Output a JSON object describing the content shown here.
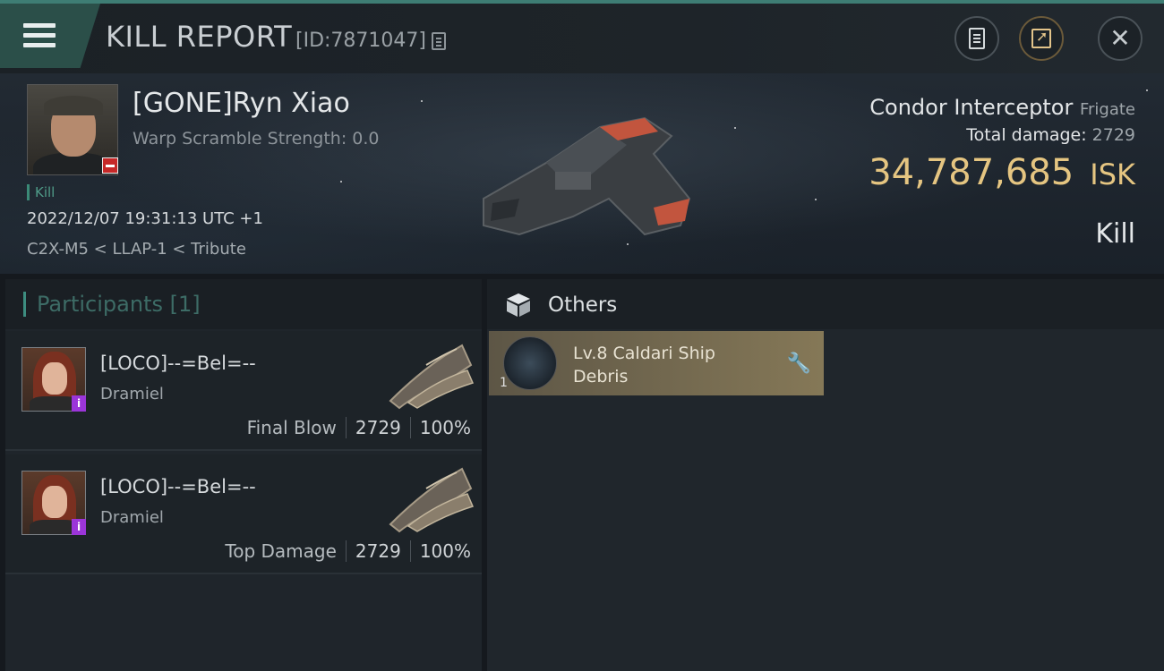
{
  "header": {
    "title": "KILL REPORT",
    "report_id": "[ID:7871047]",
    "icons": [
      "menu-icon",
      "copy-icon",
      "notes-icon",
      "share-icon",
      "close-icon"
    ]
  },
  "victim": {
    "name": "[GONE]Ryn Xiao",
    "warp_scramble": "Warp Scramble Strength: 0.0",
    "tag": "Kill",
    "datetime": "2022/12/07 19:31:13 UTC +1",
    "location": "C2X-M5 < LLAP-1 < Tribute"
  },
  "ship": {
    "name": "Condor Interceptor",
    "class": "Frigate",
    "total_damage_label": "Total damage:",
    "total_damage": "2729",
    "isk_value": "34,787,685",
    "isk_unit": "ISK",
    "result": "Kill"
  },
  "participants": {
    "title": "Participants [1]",
    "rows": [
      {
        "name": "[LOCO]--=Bel=--",
        "ship": "Dramiel",
        "role": "Final Blow",
        "damage": "2729",
        "percent": "100%"
      },
      {
        "name": "[LOCO]--=Bel=--",
        "ship": "Dramiel",
        "role": "Top Damage",
        "damage": "2729",
        "percent": "100%"
      }
    ]
  },
  "others": {
    "title": "Others",
    "items": [
      {
        "qty": "1",
        "name": "Lv.8 Caldari Ship Debris"
      }
    ]
  },
  "colors": {
    "accent_teal": "#3e7d74",
    "isk_gold": "#e5c581",
    "item_gold": "#857857",
    "info_purple": "#9b35d9",
    "minus_red": "#c62828"
  }
}
